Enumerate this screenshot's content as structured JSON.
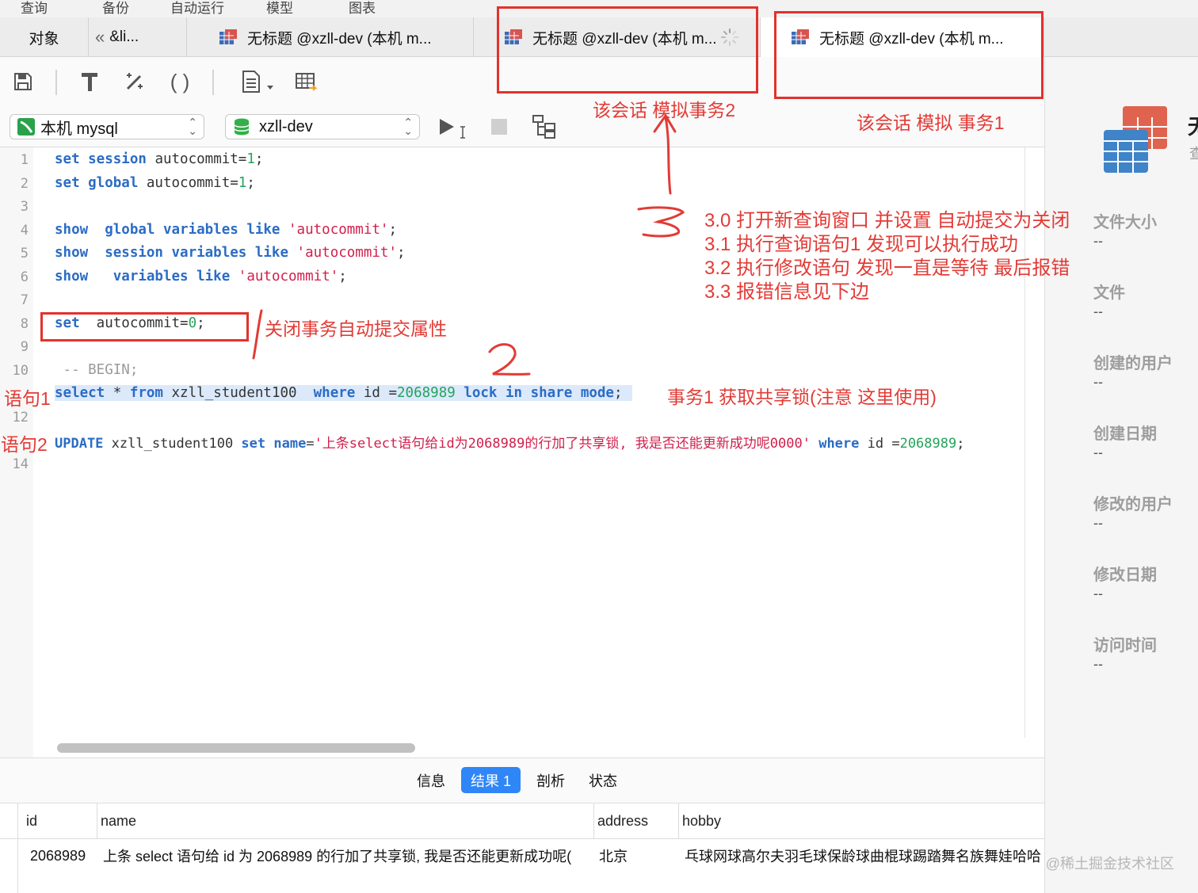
{
  "menu": {
    "items": [
      "查询",
      "备份",
      "自动运行",
      "模型",
      "图表"
    ]
  },
  "tabs": {
    "objects": "对象",
    "prev": "&li...",
    "t1": "无标题 @xzll-dev (本机 m...",
    "t2": "无标题 @xzll-dev (本机 m...",
    "t3": "无标题 @xzll-dev (本机 m..."
  },
  "connection": {
    "server": "本机 mysql",
    "database": "xzll-dev"
  },
  "editor": {
    "line_numbers": [
      "1",
      "2",
      "3",
      "4",
      "5",
      "6",
      "7",
      "8",
      "9",
      "10",
      "12",
      "14"
    ],
    "l1": {
      "kw": "set session",
      "rest": " autocommit=",
      "num": "1",
      "end": ";"
    },
    "l2": {
      "kw": "set global",
      "rest": " autocommit=",
      "num": "1",
      "end": ";"
    },
    "l4": {
      "kw": "show  global variables like",
      "str": " 'autocommit'",
      "end": ";"
    },
    "l5": {
      "kw": "show  session variables like",
      "str": " 'autocommit'",
      "end": ";"
    },
    "l6": {
      "kw": "show   variables like",
      "str": " 'autocommit'",
      "end": ";"
    },
    "l8": {
      "kw": "set",
      "rest": "  autocommit=",
      "num": "0",
      "end": ";"
    },
    "l10": " -- BEGIN;",
    "l11": {
      "kw1": "select",
      "t1": " * ",
      "kw2": "from",
      "t2": " xzll_student100  ",
      "kw3": "where",
      "t3": " id =",
      "num": "2068989",
      "kw4": " lock in share mode",
      "end": ";"
    },
    "l13": {
      "kw1": "UPDATE",
      "t1": " xzll_student100 ",
      "kw2": "set name",
      "t2": "=",
      "str": "'上条select语句给id为2068989的行加了共享锁, 我是否还能更新成功呢0000'",
      "kw3": " where",
      "t3": " id =",
      "num": "2068989",
      "end": ";"
    }
  },
  "result_tabs": [
    "信息",
    "结果 1",
    "剖析",
    "状态"
  ],
  "grid": {
    "columns": [
      "id",
      "name",
      "address",
      "hobby"
    ],
    "row": [
      "2068989",
      "上条 select 语句给 id 为 2068989 的行加了共享锁, 我是否还能更新成功呢(",
      "北京",
      "乓球网球高尔夫羽毛球保龄球曲棍球踢踏舞名族舞娃哈哈"
    ]
  },
  "info_panel": {
    "title_cut": "无",
    "sub_cut": "查",
    "labels": [
      "文件大小",
      "文件",
      "创建的用户",
      "创建日期",
      "修改的用户",
      "修改日期",
      "访问时间"
    ],
    "value": "--"
  },
  "annotations": {
    "session2": "该会话 模拟事务2",
    "session1": "该会话 模拟 事务1",
    "step30": "3.0 打开新查询窗口 并设置 自动提交为关闭",
    "step31": "3.1 执行查询语句1 发现可以执行成功",
    "step32": "3.2 执行修改语句 发现一直是等待 最后报错",
    "step33": "3.3 报错信息见下边",
    "close_autocommit": "关闭事务自动提交属性",
    "stmt1": "语句1",
    "stmt2": "语句2",
    "tx1_lock": "事务1 获取共享锁(注意 这里使用)",
    "mark3": "3",
    "mark2": "2"
  },
  "watermark": "@稀土掘金技术社区",
  "colors": {
    "accent": "#2f86f6",
    "annotation": "#e23b36",
    "keyword": "#2b6cc4",
    "string": "#d11f4b",
    "number": "#24a35c"
  }
}
